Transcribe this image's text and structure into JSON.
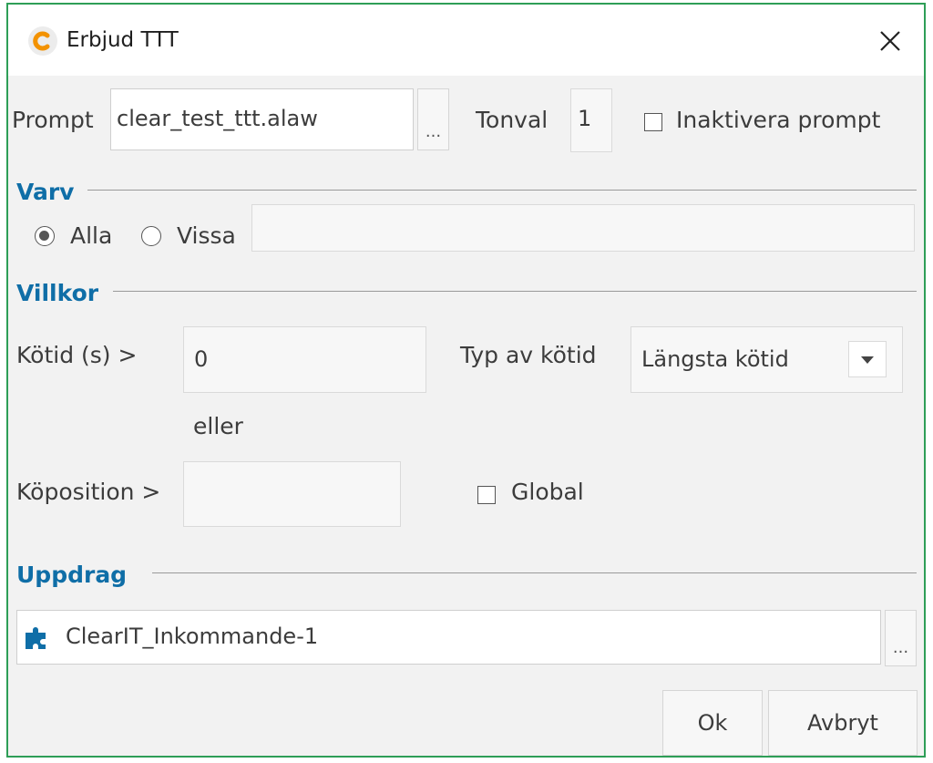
{
  "window": {
    "title": "Erbjud TTT",
    "icon": "app-logo-icon",
    "close_icon": "close-icon"
  },
  "prompt_row": {
    "prompt_label": "Prompt",
    "prompt_value": "clear_test_ttt.alaw",
    "browse_label": "...",
    "tonval_label": "Tonval",
    "tonval_value": "1",
    "inaktivera_label": "Inaktivera prompt",
    "inaktivera_checked": false
  },
  "varv": {
    "heading": "Varv",
    "option_alla": "Alla",
    "option_vissa": "Vissa",
    "selected": "Alla",
    "vissa_value": ""
  },
  "villkor": {
    "heading": "Villkor",
    "kotid_label": "Kötid (s) >",
    "kotid_value": "0",
    "typ_label": "Typ av kötid",
    "typ_value": "Längsta kötid",
    "eller_label": "eller",
    "koposition_label": "Köposition >",
    "koposition_value": "",
    "global_label": "Global",
    "global_checked": false
  },
  "uppdrag": {
    "heading": "Uppdrag",
    "item_icon": "puzzle-icon",
    "item_value": "ClearIT_Inkommande-1",
    "browse_label": "..."
  },
  "buttons": {
    "ok_label": "Ok",
    "cancel_label": "Avbryt"
  },
  "colors": {
    "accent": "#0f6ea7",
    "border": "#2e9e57",
    "logo": "#f39200"
  }
}
